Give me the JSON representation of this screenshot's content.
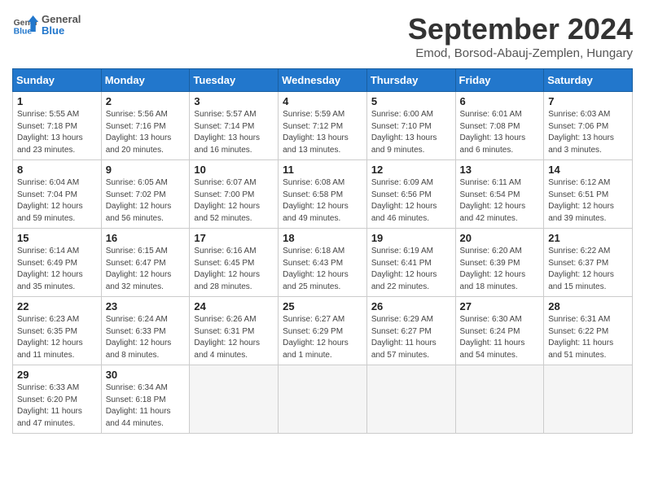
{
  "header": {
    "logo": {
      "line1": "General",
      "line2": "Blue"
    },
    "title": "September 2024",
    "location": "Emod, Borsod-Abauj-Zemplen, Hungary"
  },
  "weekdays": [
    "Sunday",
    "Monday",
    "Tuesday",
    "Wednesday",
    "Thursday",
    "Friday",
    "Saturday"
  ],
  "weeks": [
    [
      {
        "day": "1",
        "info": "Sunrise: 5:55 AM\nSunset: 7:18 PM\nDaylight: 13 hours\nand 23 minutes."
      },
      {
        "day": "2",
        "info": "Sunrise: 5:56 AM\nSunset: 7:16 PM\nDaylight: 13 hours\nand 20 minutes."
      },
      {
        "day": "3",
        "info": "Sunrise: 5:57 AM\nSunset: 7:14 PM\nDaylight: 13 hours\nand 16 minutes."
      },
      {
        "day": "4",
        "info": "Sunrise: 5:59 AM\nSunset: 7:12 PM\nDaylight: 13 hours\nand 13 minutes."
      },
      {
        "day": "5",
        "info": "Sunrise: 6:00 AM\nSunset: 7:10 PM\nDaylight: 13 hours\nand 9 minutes."
      },
      {
        "day": "6",
        "info": "Sunrise: 6:01 AM\nSunset: 7:08 PM\nDaylight: 13 hours\nand 6 minutes."
      },
      {
        "day": "7",
        "info": "Sunrise: 6:03 AM\nSunset: 7:06 PM\nDaylight: 13 hours\nand 3 minutes."
      }
    ],
    [
      {
        "day": "8",
        "info": "Sunrise: 6:04 AM\nSunset: 7:04 PM\nDaylight: 12 hours\nand 59 minutes."
      },
      {
        "day": "9",
        "info": "Sunrise: 6:05 AM\nSunset: 7:02 PM\nDaylight: 12 hours\nand 56 minutes."
      },
      {
        "day": "10",
        "info": "Sunrise: 6:07 AM\nSunset: 7:00 PM\nDaylight: 12 hours\nand 52 minutes."
      },
      {
        "day": "11",
        "info": "Sunrise: 6:08 AM\nSunset: 6:58 PM\nDaylight: 12 hours\nand 49 minutes."
      },
      {
        "day": "12",
        "info": "Sunrise: 6:09 AM\nSunset: 6:56 PM\nDaylight: 12 hours\nand 46 minutes."
      },
      {
        "day": "13",
        "info": "Sunrise: 6:11 AM\nSunset: 6:54 PM\nDaylight: 12 hours\nand 42 minutes."
      },
      {
        "day": "14",
        "info": "Sunrise: 6:12 AM\nSunset: 6:51 PM\nDaylight: 12 hours\nand 39 minutes."
      }
    ],
    [
      {
        "day": "15",
        "info": "Sunrise: 6:14 AM\nSunset: 6:49 PM\nDaylight: 12 hours\nand 35 minutes."
      },
      {
        "day": "16",
        "info": "Sunrise: 6:15 AM\nSunset: 6:47 PM\nDaylight: 12 hours\nand 32 minutes."
      },
      {
        "day": "17",
        "info": "Sunrise: 6:16 AM\nSunset: 6:45 PM\nDaylight: 12 hours\nand 28 minutes."
      },
      {
        "day": "18",
        "info": "Sunrise: 6:18 AM\nSunset: 6:43 PM\nDaylight: 12 hours\nand 25 minutes."
      },
      {
        "day": "19",
        "info": "Sunrise: 6:19 AM\nSunset: 6:41 PM\nDaylight: 12 hours\nand 22 minutes."
      },
      {
        "day": "20",
        "info": "Sunrise: 6:20 AM\nSunset: 6:39 PM\nDaylight: 12 hours\nand 18 minutes."
      },
      {
        "day": "21",
        "info": "Sunrise: 6:22 AM\nSunset: 6:37 PM\nDaylight: 12 hours\nand 15 minutes."
      }
    ],
    [
      {
        "day": "22",
        "info": "Sunrise: 6:23 AM\nSunset: 6:35 PM\nDaylight: 12 hours\nand 11 minutes."
      },
      {
        "day": "23",
        "info": "Sunrise: 6:24 AM\nSunset: 6:33 PM\nDaylight: 12 hours\nand 8 minutes."
      },
      {
        "day": "24",
        "info": "Sunrise: 6:26 AM\nSunset: 6:31 PM\nDaylight: 12 hours\nand 4 minutes."
      },
      {
        "day": "25",
        "info": "Sunrise: 6:27 AM\nSunset: 6:29 PM\nDaylight: 12 hours\nand 1 minute."
      },
      {
        "day": "26",
        "info": "Sunrise: 6:29 AM\nSunset: 6:27 PM\nDaylight: 11 hours\nand 57 minutes."
      },
      {
        "day": "27",
        "info": "Sunrise: 6:30 AM\nSunset: 6:24 PM\nDaylight: 11 hours\nand 54 minutes."
      },
      {
        "day": "28",
        "info": "Sunrise: 6:31 AM\nSunset: 6:22 PM\nDaylight: 11 hours\nand 51 minutes."
      }
    ],
    [
      {
        "day": "29",
        "info": "Sunrise: 6:33 AM\nSunset: 6:20 PM\nDaylight: 11 hours\nand 47 minutes."
      },
      {
        "day": "30",
        "info": "Sunrise: 6:34 AM\nSunset: 6:18 PM\nDaylight: 11 hours\nand 44 minutes."
      },
      {
        "day": "",
        "info": ""
      },
      {
        "day": "",
        "info": ""
      },
      {
        "day": "",
        "info": ""
      },
      {
        "day": "",
        "info": ""
      },
      {
        "day": "",
        "info": ""
      }
    ]
  ]
}
